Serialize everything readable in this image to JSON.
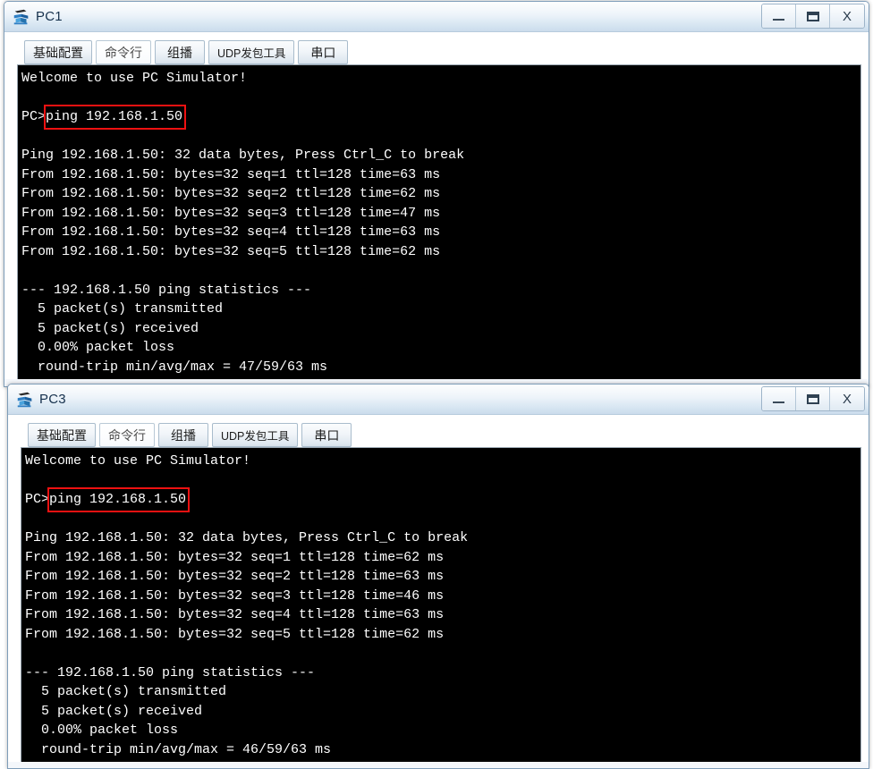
{
  "windows": [
    {
      "title": "PC1",
      "icon": "pc-device-icon",
      "controls": {
        "minimize": "–",
        "maximize": "▭",
        "close": "X"
      },
      "tabs": [
        {
          "label": "基础配置",
          "selected": false
        },
        {
          "label": "命令行",
          "selected": true
        },
        {
          "label": "组播",
          "selected": false
        },
        {
          "label": "UDP发包工具",
          "selected": false,
          "small": true
        },
        {
          "label": "串口",
          "selected": false
        }
      ],
      "terminal": {
        "lines": [
          "Welcome to use PC Simulator!",
          "",
          "PC>ping 192.168.1.50",
          "",
          "Ping 192.168.1.50: 32 data bytes, Press Ctrl_C to break",
          "From 192.168.1.50: bytes=32 seq=1 ttl=128 time=63 ms",
          "From 192.168.1.50: bytes=32 seq=2 ttl=128 time=62 ms",
          "From 192.168.1.50: bytes=32 seq=3 ttl=128 time=47 ms",
          "From 192.168.1.50: bytes=32 seq=4 ttl=128 time=63 ms",
          "From 192.168.1.50: bytes=32 seq=5 ttl=128 time=62 ms",
          "",
          "--- 192.168.1.50 ping statistics ---",
          "  5 packet(s) transmitted",
          "  5 packet(s) received",
          "  0.00% packet loss",
          "  round-trip min/avg/max = 47/59/63 ms"
        ],
        "highlight": {
          "command": "ping 192.168.1.50",
          "color": "#ee1111"
        }
      }
    },
    {
      "title": "PC3",
      "icon": "pc-device-icon",
      "controls": {
        "minimize": "–",
        "maximize": "▭",
        "close": "X"
      },
      "tabs": [
        {
          "label": "基础配置",
          "selected": false
        },
        {
          "label": "命令行",
          "selected": true
        },
        {
          "label": "组播",
          "selected": false
        },
        {
          "label": "UDP发包工具",
          "selected": false,
          "small": true
        },
        {
          "label": "串口",
          "selected": false
        }
      ],
      "terminal": {
        "lines": [
          "Welcome to use PC Simulator!",
          "",
          "PC>ping 192.168.1.50",
          "",
          "Ping 192.168.1.50: 32 data bytes, Press Ctrl_C to break",
          "From 192.168.1.50: bytes=32 seq=1 ttl=128 time=62 ms",
          "From 192.168.1.50: bytes=32 seq=2 ttl=128 time=63 ms",
          "From 192.168.1.50: bytes=32 seq=3 ttl=128 time=46 ms",
          "From 192.168.1.50: bytes=32 seq=4 ttl=128 time=63 ms",
          "From 192.168.1.50: bytes=32 seq=5 ttl=128 time=62 ms",
          "",
          "--- 192.168.1.50 ping statistics ---",
          "  5 packet(s) transmitted",
          "  5 packet(s) received",
          "  0.00% packet loss",
          "  round-trip min/avg/max = 46/59/63 ms"
        ],
        "highlight": {
          "command": "ping 192.168.1.50",
          "color": "#ee1111"
        }
      }
    }
  ],
  "colors": {
    "titlebar_top": "#fdfefe",
    "titlebar_bottom": "#cbdcec",
    "window_border": "#7e9db9",
    "terminal_bg": "#000000",
    "terminal_fg": "#ffffff",
    "highlight": "#ee1111"
  }
}
